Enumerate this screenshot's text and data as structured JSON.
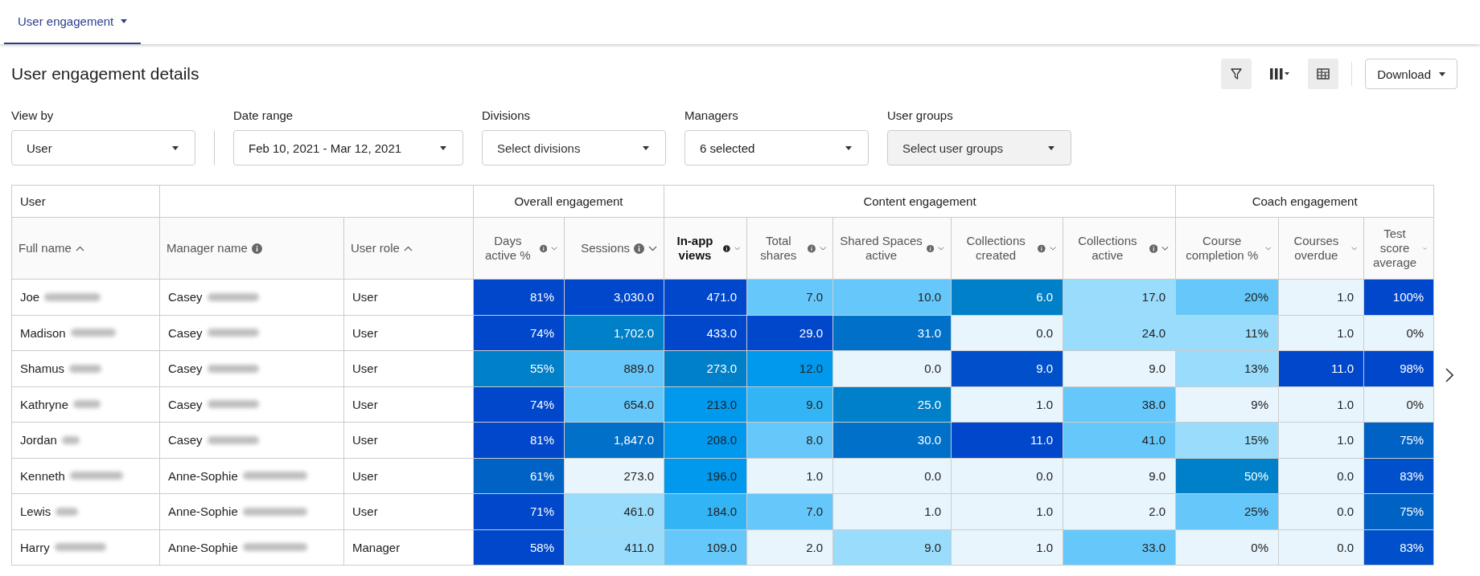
{
  "tabs": [
    {
      "label": "User engagement",
      "selected": true
    }
  ],
  "title": "User engagement details",
  "toolbar": [
    {
      "kind": "filter",
      "selected": true
    },
    {
      "kind": "columns",
      "selected": false
    },
    {
      "kind": "table",
      "selected": true
    }
  ],
  "download": {
    "label": "Download"
  },
  "filters": [
    {
      "label": "View by",
      "value": "User",
      "separated": true
    },
    {
      "label": "Date range",
      "value": "Feb 10, 2021 - Mar 12, 2021",
      "separated": false
    },
    {
      "label": "Divisions",
      "placeholder": "Select divisions",
      "separated": false
    },
    {
      "label": "Managers",
      "value": "6 selected",
      "separated": false
    },
    {
      "label": "User groups",
      "placeholder": "Select user groups",
      "separated": false,
      "disabled": true
    }
  ],
  "table": {
    "groups": [
      {
        "label": "User",
        "columns": [
          {
            "label": "Full name",
            "info": false,
            "sortable": true,
            "ascending": true,
            "active": false
          }
        ]
      },
      {
        "columns": [
          {
            "label": "Manager name",
            "info": true,
            "sortable": false,
            "active": false
          },
          {
            "label": "User role",
            "info": false,
            "sortable": true,
            "ascending": true,
            "active": false
          }
        ]
      },
      {
        "label": "Overall engagement",
        "columns": [
          {
            "label": "Days active %",
            "info": true,
            "sortable": true,
            "ascending": false,
            "active": false
          },
          {
            "label": "Sessions",
            "info": true,
            "sortable": true,
            "ascending": false,
            "active": false
          }
        ]
      },
      {
        "label": "Content engagement",
        "columns": [
          {
            "label": "In-app views",
            "info": true,
            "sortable": true,
            "ascending": false,
            "active": true
          },
          {
            "label": "Total shares",
            "info": true,
            "sortable": true,
            "ascending": false,
            "active": false
          },
          {
            "label": "Shared Spaces active",
            "info": true,
            "sortable": true,
            "ascending": false,
            "active": false
          },
          {
            "label": "Collections created",
            "info": true,
            "sortable": true,
            "ascending": false,
            "active": false
          },
          {
            "label": "Collections active",
            "info": true,
            "sortable": true,
            "ascending": false,
            "active": false
          }
        ]
      },
      {
        "label": "Coach engagement",
        "columns": [
          {
            "label": "Course completion %",
            "info": false,
            "sortable": true,
            "ascending": false,
            "active": false
          },
          {
            "label": "Courses overdue",
            "info": false,
            "sortable": true,
            "ascending": false,
            "active": false
          },
          {
            "label": "Test score average",
            "info": false,
            "sortable": true,
            "ascending": false,
            "active": false
          }
        ]
      }
    ],
    "rows": [
      {
        "cells": [
          {
            "text": "Joe",
            "redacted": true
          },
          {
            "text": "Casey",
            "redacted": true
          },
          {
            "text": "User",
            "redacted": false
          },
          {
            "text": "81%",
            "color": "#0047cc"
          },
          {
            "text": "3,030.0",
            "color": "#0047cc"
          },
          {
            "text": "471.0",
            "color": "#0047cc"
          },
          {
            "text": "7.0",
            "color": "#66c8fa"
          },
          {
            "text": "10.0",
            "color": "#66c8fa"
          },
          {
            "text": "6.0",
            "color": "#0080c8"
          },
          {
            "text": "17.0",
            "color": "#99dcfb"
          },
          {
            "text": "20%",
            "color": "#66c8fa"
          },
          {
            "text": "1.0",
            "color": "#e8f5fc"
          },
          {
            "text": "100%",
            "color": "#0047cc"
          }
        ]
      },
      {
        "cells": [
          {
            "text": "Madison",
            "redacted": true
          },
          {
            "text": "Casey",
            "redacted": true
          },
          {
            "text": "User",
            "redacted": false
          },
          {
            "text": "74%",
            "color": "#0047cc"
          },
          {
            "text": "1,702.0",
            "color": "#0080c8"
          },
          {
            "text": "433.0",
            "color": "#0047cc"
          },
          {
            "text": "29.0",
            "color": "#0047cc"
          },
          {
            "text": "31.0",
            "color": "#0070c9"
          },
          {
            "text": "0.0",
            "color": "#e8f5fc"
          },
          {
            "text": "24.0",
            "color": "#99dcfb"
          },
          {
            "text": "11%",
            "color": "#99dcfb"
          },
          {
            "text": "1.0",
            "color": "#e8f5fc"
          },
          {
            "text": "0%",
            "color": "#e8f5fc"
          }
        ]
      },
      {
        "cells": [
          {
            "text": "Shamus",
            "redacted": true
          },
          {
            "text": "Casey",
            "redacted": true
          },
          {
            "text": "User",
            "redacted": false
          },
          {
            "text": "55%",
            "color": "#0080c8"
          },
          {
            "text": "889.0",
            "color": "#66c8fa"
          },
          {
            "text": "273.0",
            "color": "#0080c8"
          },
          {
            "text": "12.0",
            "color": "#0099ee"
          },
          {
            "text": "0.0",
            "color": "#e8f5fc"
          },
          {
            "text": "9.0",
            "color": "#0050cc"
          },
          {
            "text": "9.0",
            "color": "#e8f5fc"
          },
          {
            "text": "13%",
            "color": "#99dcfb"
          },
          {
            "text": "11.0",
            "color": "#0047cc"
          },
          {
            "text": "98%",
            "color": "#0047cc"
          }
        ]
      },
      {
        "cells": [
          {
            "text": "Kathryne",
            "redacted": true
          },
          {
            "text": "Casey",
            "redacted": true
          },
          {
            "text": "User",
            "redacted": false
          },
          {
            "text": "74%",
            "color": "#0047cc"
          },
          {
            "text": "654.0",
            "color": "#66c8fa"
          },
          {
            "text": "213.0",
            "color": "#0099ee"
          },
          {
            "text": "9.0",
            "color": "#33b5f5"
          },
          {
            "text": "25.0",
            "color": "#0080c8"
          },
          {
            "text": "1.0",
            "color": "#e8f5fc"
          },
          {
            "text": "38.0",
            "color": "#66c8fa"
          },
          {
            "text": "9%",
            "color": "#e8f5fc"
          },
          {
            "text": "1.0",
            "color": "#e8f5fc"
          },
          {
            "text": "0%",
            "color": "#e8f5fc"
          }
        ]
      },
      {
        "cells": [
          {
            "text": "Jordan",
            "redacted": true
          },
          {
            "text": "Casey",
            "redacted": true
          },
          {
            "text": "User",
            "redacted": false
          },
          {
            "text": "81%",
            "color": "#0047cc"
          },
          {
            "text": "1,847.0",
            "color": "#0070c9"
          },
          {
            "text": "208.0",
            "color": "#0099ee"
          },
          {
            "text": "8.0",
            "color": "#66c8fa"
          },
          {
            "text": "30.0",
            "color": "#0070c9"
          },
          {
            "text": "11.0",
            "color": "#0047cc"
          },
          {
            "text": "41.0",
            "color": "#66c8fa"
          },
          {
            "text": "15%",
            "color": "#99dcfb"
          },
          {
            "text": "1.0",
            "color": "#e8f5fc"
          },
          {
            "text": "75%",
            "color": "#0062c4"
          }
        ]
      },
      {
        "cells": [
          {
            "text": "Kenneth",
            "redacted": true
          },
          {
            "text": "Anne-Sophie",
            "redacted": true
          },
          {
            "text": "User",
            "redacted": false
          },
          {
            "text": "61%",
            "color": "#0062c4"
          },
          {
            "text": "273.0",
            "color": "#e8f5fc"
          },
          {
            "text": "196.0",
            "color": "#0099ee"
          },
          {
            "text": "1.0",
            "color": "#e8f5fc"
          },
          {
            "text": "0.0",
            "color": "#e8f5fc"
          },
          {
            "text": "0.0",
            "color": "#e8f5fc"
          },
          {
            "text": "9.0",
            "color": "#e8f5fc"
          },
          {
            "text": "50%",
            "color": "#0080c8"
          },
          {
            "text": "0.0",
            "color": "#e8f5fc"
          },
          {
            "text": "83%",
            "color": "#0050cc"
          }
        ]
      },
      {
        "cells": [
          {
            "text": "Lewis",
            "redacted": true
          },
          {
            "text": "Anne-Sophie",
            "redacted": true
          },
          {
            "text": "User",
            "redacted": false
          },
          {
            "text": "71%",
            "color": "#0047cc"
          },
          {
            "text": "461.0",
            "color": "#99dcfb"
          },
          {
            "text": "184.0",
            "color": "#33b5f5"
          },
          {
            "text": "7.0",
            "color": "#66c8fa"
          },
          {
            "text": "1.0",
            "color": "#e8f5fc"
          },
          {
            "text": "1.0",
            "color": "#e8f5fc"
          },
          {
            "text": "2.0",
            "color": "#e8f5fc"
          },
          {
            "text": "25%",
            "color": "#66c8fa"
          },
          {
            "text": "0.0",
            "color": "#e8f5fc"
          },
          {
            "text": "75%",
            "color": "#0062c4"
          }
        ]
      },
      {
        "cells": [
          {
            "text": "Harry",
            "redacted": true
          },
          {
            "text": "Anne-Sophie",
            "redacted": true
          },
          {
            "text": "Manager",
            "redacted": false
          },
          {
            "text": "58%",
            "color": "#0047cc"
          },
          {
            "text": "411.0",
            "color": "#99dcfb"
          },
          {
            "text": "109.0",
            "color": "#66c8fa"
          },
          {
            "text": "2.0",
            "color": "#e8f5fc"
          },
          {
            "text": "9.0",
            "color": "#99dcfb"
          },
          {
            "text": "1.0",
            "color": "#e8f5fc"
          },
          {
            "text": "33.0",
            "color": "#66c8fa"
          },
          {
            "text": "0%",
            "color": "#e8f5fc"
          },
          {
            "text": "0.0",
            "color": "#e8f5fc"
          },
          {
            "text": "83%",
            "color": "#0050cc"
          }
        ]
      }
    ]
  }
}
